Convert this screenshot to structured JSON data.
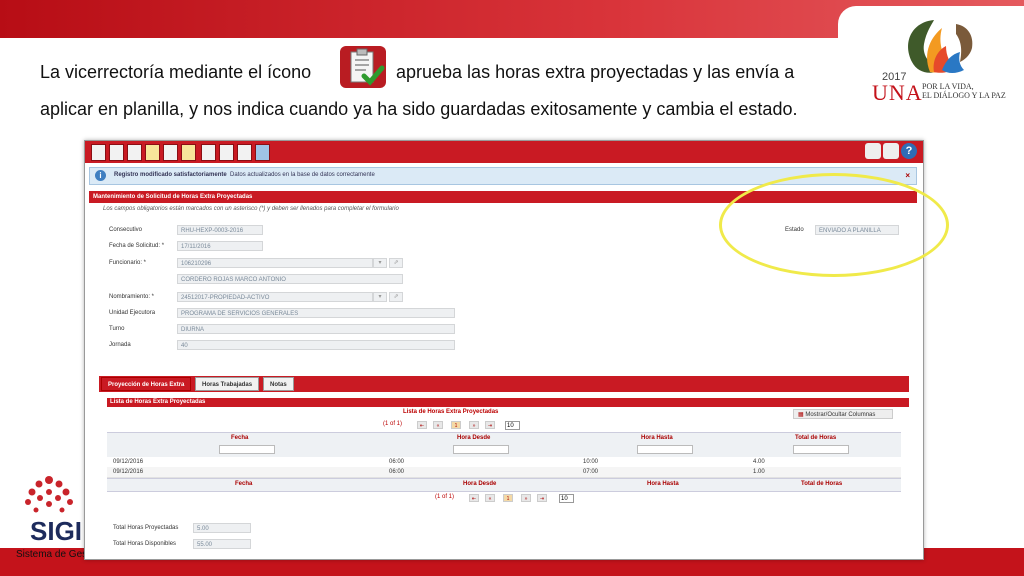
{
  "slide": {
    "line1_a": "La vicerrectoría mediante el ícono",
    "line1_b": "aprueba las horas extra proyectadas y las envía a",
    "line2": "aplicar en planilla, y nos indica cuando ya ha sido guardadas exitosamente y cambia el estado.",
    "approve_icon": "clipboard-check-icon"
  },
  "logo": {
    "year": "2017",
    "name": "UNA",
    "tagline1": "POR LA VIDA,",
    "tagline2": "EL DIÁLOGO Y LA PAZ"
  },
  "sigi": {
    "brand": "SIGI",
    "caption": "Sistema de Gestión"
  },
  "message": {
    "title": "Registro modificado satisfactoriamente",
    "detail": "Datos actualizados en la base de datos correctamente",
    "close": "×"
  },
  "form": {
    "panel_title": "Mantenimiento de Solicitud de Horas Extra Proyectadas",
    "note": "Los campos obligatorios están marcados con un asterisco (*) y deben ser llenados para completar el formulario",
    "consecutivo_label": "Consecutivo",
    "consecutivo_value": "RHU-HEXP-0003-2016",
    "fecha_label": "Fecha de Solicitud: *",
    "fecha_value": "17/11/2016",
    "funcionario_label": "Funcionario: *",
    "funcionario_id": "106210296",
    "funcionario_name": "CORDERO ROJAS MARCO ANTONIO",
    "nombramiento_label": "Nombramiento: *",
    "nombramiento_value": "24512017-PROPIEDAD-ACTIVO",
    "unidad_label": "Unidad Ejecutora",
    "unidad_value": "PROGRAMA DE SERVICIOS GENERALES",
    "turno_label": "Turno",
    "turno_value": "DIURNA",
    "jornada_label": "Jornada",
    "jornada_value": "40",
    "estado_label": "Estado",
    "estado_value": "ENVIADO A PLANILLA"
  },
  "tabs": [
    "Proyección de Horas Extra",
    "Horas Trabajadas",
    "Notas"
  ],
  "grid": {
    "list_title": "Lista de Horas Extra Proyectadas",
    "title": "Lista de Horas Extra Proyectadas",
    "toggle_columns": "Mostrar/Ocultar Columnas",
    "page_info": "(1 of 1)",
    "page_num": "1",
    "rows_per_page": "10",
    "columns": [
      "Fecha",
      "Hora Desde",
      "Hora Hasta",
      "Total de Horas"
    ],
    "footer_columns": [
      "Fecha",
      "Hora Desde",
      "Hora Hasta",
      "Total de Horas"
    ],
    "rows": [
      [
        "09/12/2016",
        "06:00",
        "10:00",
        "4.00"
      ],
      [
        "09/12/2016",
        "06:00",
        "07:00",
        "1.00"
      ]
    ]
  },
  "totals": {
    "proyectadas_label": "Total Horas Proyectadas",
    "proyectadas_value": "5.00",
    "disponibles_label": "Total Horas Disponibles",
    "disponibles_value": "55.00"
  }
}
